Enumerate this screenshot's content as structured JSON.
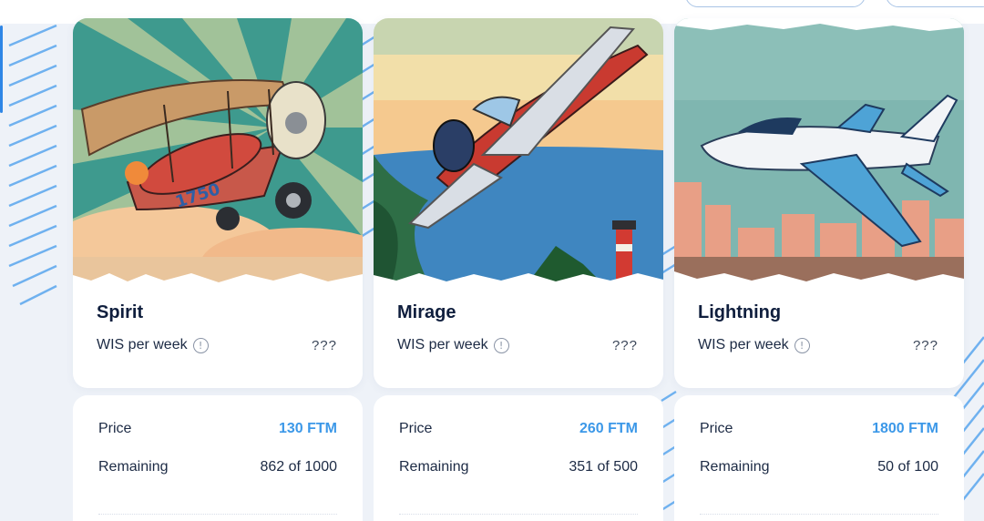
{
  "colors": {
    "background": "#eef2f8",
    "card": "#ffffff",
    "title": "#0f1e3d",
    "price_accent": "#3c98e8",
    "stripes": "#5aa6ee"
  },
  "info_icon_glyph": "!",
  "cards": [
    {
      "name": "Spirit",
      "wis_label": "WIS per week",
      "wis_value": "???",
      "price_label": "Price",
      "price_value": "130 FTM",
      "remaining_label": "Remaining",
      "remaining_value": "862 of 1000",
      "art_text": "1750"
    },
    {
      "name": "Mirage",
      "wis_label": "WIS per week",
      "wis_value": "???",
      "price_label": "Price",
      "price_value": "260 FTM",
      "remaining_label": "Remaining",
      "remaining_value": "351 of 500"
    },
    {
      "name": "Lightning",
      "wis_label": "WIS per week",
      "wis_value": "???",
      "price_label": "Price",
      "price_value": "1800 FTM",
      "remaining_label": "Remaining",
      "remaining_value": "50 of 100"
    }
  ]
}
